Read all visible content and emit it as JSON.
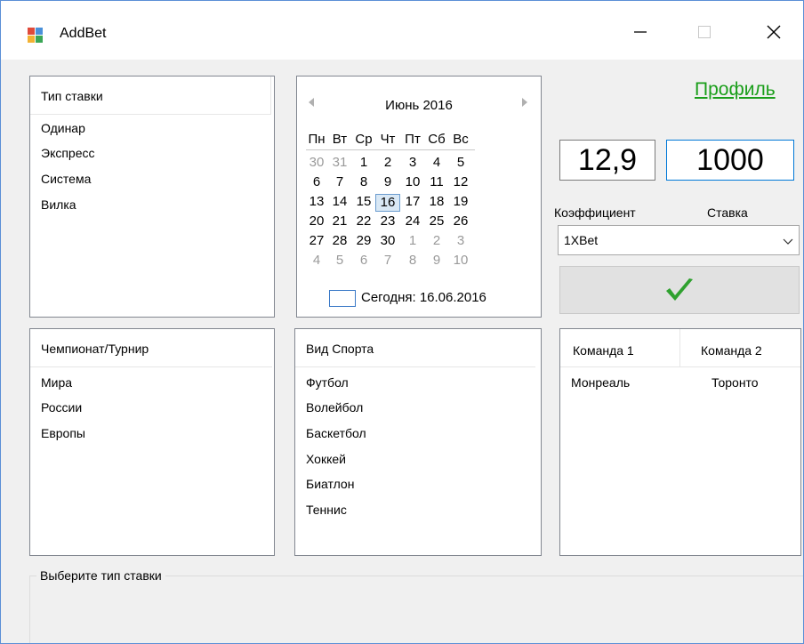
{
  "window": {
    "title": "AddBet"
  },
  "bet_type": {
    "header": "Тип ставки",
    "items": [
      "Одинар",
      "Экспресс",
      "Система",
      "Вилка"
    ]
  },
  "calendar": {
    "month_label": "Июнь 2016",
    "weekdays": [
      "Пн",
      "Вт",
      "Ср",
      "Чт",
      "Пт",
      "Сб",
      "Вс"
    ],
    "weeks": [
      [
        "30",
        "31",
        "1",
        "2",
        "3",
        "4",
        "5"
      ],
      [
        "6",
        "7",
        "8",
        "9",
        "10",
        "11",
        "12"
      ],
      [
        "13",
        "14",
        "15",
        "16",
        "17",
        "18",
        "19"
      ],
      [
        "20",
        "21",
        "22",
        "23",
        "24",
        "25",
        "26"
      ],
      [
        "27",
        "28",
        "29",
        "30",
        "1",
        "2",
        "3"
      ],
      [
        "4",
        "5",
        "6",
        "7",
        "8",
        "9",
        "10"
      ]
    ],
    "selected_day": "16",
    "today_label": "Сегодня: 16.06.2016"
  },
  "profile_link": "Профиль",
  "coefficient": {
    "value": "12,9",
    "label": "Коэффициент"
  },
  "stake": {
    "value": "1000",
    "label": "Ставка"
  },
  "bookmaker": {
    "selected": "1XBet"
  },
  "championship": {
    "header": "Чемпионат/Турнир",
    "items": [
      "Мира",
      "России",
      "Европы"
    ]
  },
  "sport": {
    "header": "Вид Спорта",
    "items": [
      "Футбол",
      "Волейбол",
      "Баскетбол",
      "Хоккей",
      "Биатлон",
      "Теннис"
    ]
  },
  "teams": {
    "col1": "Команда 1",
    "col2": "Команда 2",
    "rows": [
      {
        "team1": "Монреаль",
        "team2": "Торонто"
      }
    ]
  },
  "status_group": {
    "title": "Выберите тип ставки"
  },
  "colors": {
    "accent": "#0078d7",
    "link": "#1a9e1a",
    "check": "#2fa12f"
  }
}
